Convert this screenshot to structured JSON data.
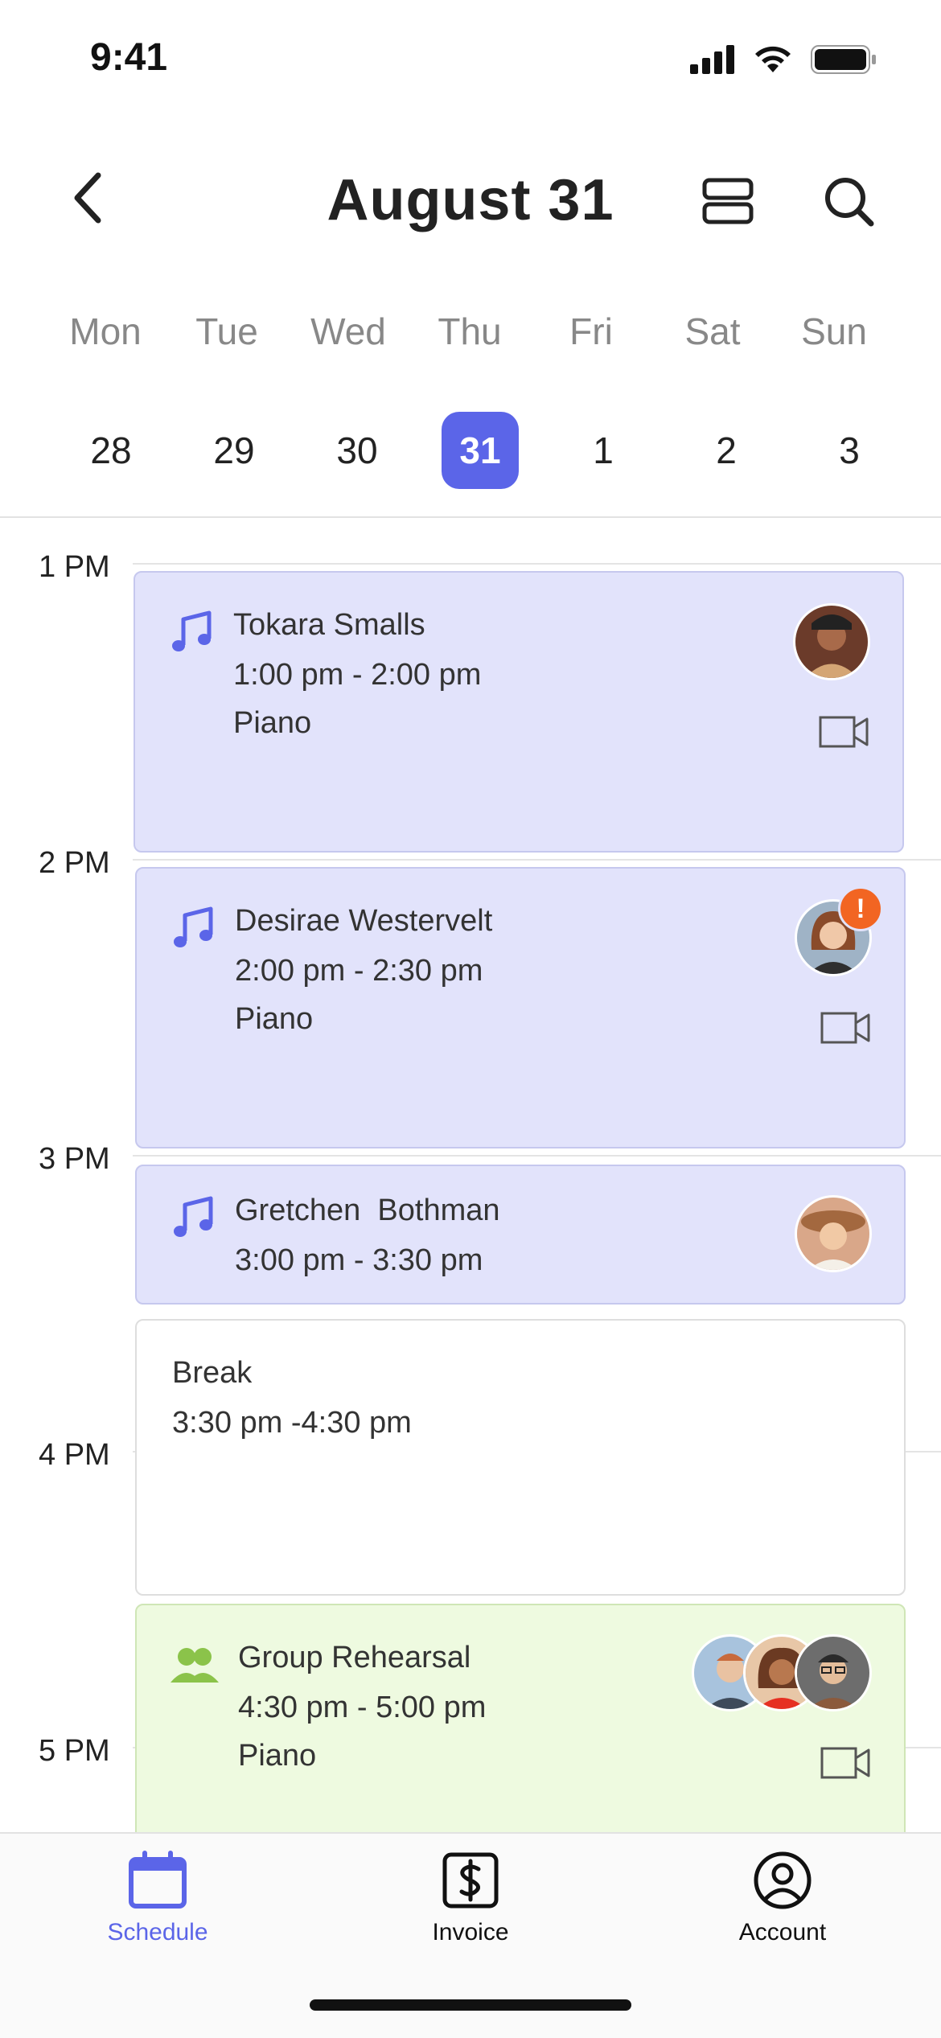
{
  "status": {
    "time": "9:41"
  },
  "header": {
    "title": "August 31"
  },
  "week": {
    "days": [
      "Mon",
      "Tue",
      "Wed",
      "Thu",
      "Fri",
      "Sat",
      "Sun"
    ],
    "dates": [
      "28",
      "29",
      "30",
      "31",
      "1",
      "2",
      "3"
    ],
    "selected_index": 3
  },
  "timeline": {
    "hours": [
      "1 PM",
      "2 PM",
      "3 PM",
      "4 PM",
      "5 PM"
    ]
  },
  "events": [
    {
      "name": "Tokara Smalls",
      "time": "1:00 pm - 2:00 pm",
      "subject": "Piano",
      "type": "lesson",
      "icon": "music-note-icon",
      "video": true
    },
    {
      "name": "Desirae Westervelt",
      "time": "2:00 pm - 2:30 pm",
      "subject": "Piano",
      "type": "lesson",
      "icon": "music-note-icon",
      "video": true,
      "alert": "!"
    },
    {
      "name": "Gretchen  Bothman",
      "time": "3:00 pm - 3:30 pm",
      "type": "lesson",
      "icon": "music-note-icon",
      "video": false
    },
    {
      "name": "Break",
      "time": "3:30 pm -4:30 pm",
      "type": "break"
    },
    {
      "name": "Group Rehearsal",
      "time": "4:30 pm - 5:00 pm",
      "subject": "Piano",
      "type": "group",
      "icon": "group-icon",
      "video": true
    }
  ],
  "tabs": [
    {
      "label": "Schedule",
      "icon": "calendar-icon",
      "active": true
    },
    {
      "label": "Invoice",
      "icon": "dollar-icon",
      "active": false
    },
    {
      "label": "Account",
      "icon": "user-icon",
      "active": false
    }
  ],
  "colors": {
    "accent": "#5b65e8",
    "lesson_bg": "#e2e3fb",
    "group_bg": "#eefae0",
    "alert": "#f26522",
    "group_icon": "#8bc34a"
  }
}
